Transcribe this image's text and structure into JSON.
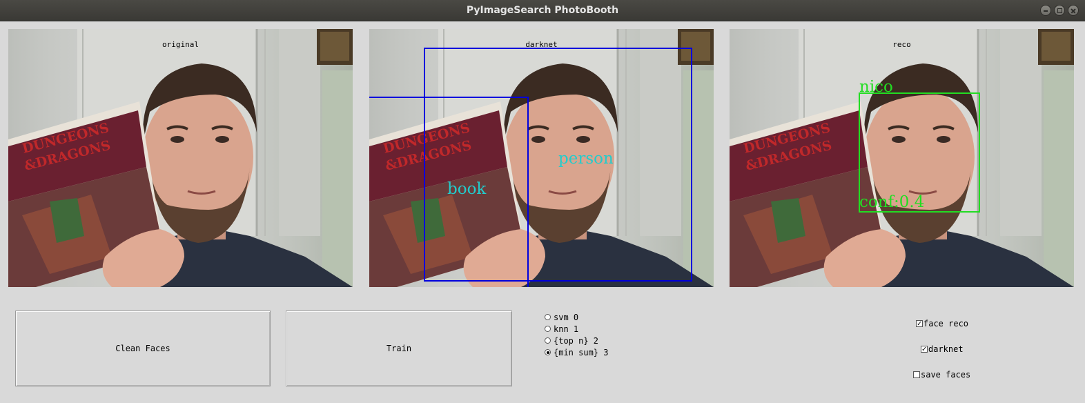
{
  "window": {
    "title": "PyImageSearch PhotoBooth"
  },
  "panels": [
    {
      "label": "original",
      "detections": []
    },
    {
      "label": "darknet",
      "detections": [
        {
          "label": "person",
          "color": "#0000dd",
          "label_color": "#22cccc"
        },
        {
          "label": "book",
          "color": "#0000dd",
          "label_color": "#22cccc"
        }
      ]
    },
    {
      "label": "reco",
      "detections": [
        {
          "label": "nico",
          "conf_text": "conf:0.4",
          "color": "#22dd22",
          "label_color": "#22dd22"
        }
      ]
    }
  ],
  "buttons": {
    "clean_faces": "Clean Faces",
    "train": "Train"
  },
  "classifiers": {
    "options": [
      "svm 0",
      "knn 1",
      "{top n} 2",
      "{min sum} 3"
    ],
    "selected": "{min sum} 3"
  },
  "toggles": {
    "face_reco": {
      "label": "face reco",
      "checked": true
    },
    "darknet": {
      "label": "darknet",
      "checked": true
    },
    "save_faces": {
      "label": "save faces",
      "checked": false
    }
  },
  "colors": {
    "window_bg": "#d9d9d9",
    "titlebar": "#3f3e3a",
    "darknet_box": "#0000dd",
    "reco_box": "#22dd22"
  }
}
